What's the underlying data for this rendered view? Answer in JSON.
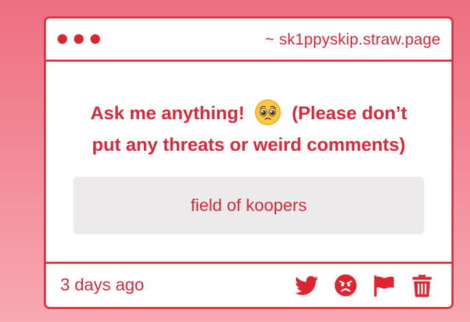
{
  "window": {
    "url": "~ sk1ppyskip.straw.page",
    "dot_count": 3
  },
  "question": {
    "text_before_emoji": "Ask me anything!",
    "emoji": "pleading-face-emoji",
    "text_after_emoji": "(Please don’t put any threats or weird comments)"
  },
  "answer": {
    "text": "field of koopers"
  },
  "footer": {
    "timestamp": "3 days ago",
    "actions": [
      "twitter-icon",
      "angry-face-icon",
      "flag-icon",
      "trash-icon"
    ]
  },
  "colors": {
    "accent": "#e0303c",
    "text": "#d8283a",
    "answer_bg": "#eceaeb",
    "background_top": "#ee6f7f",
    "background_bottom": "#f7a9b4"
  }
}
